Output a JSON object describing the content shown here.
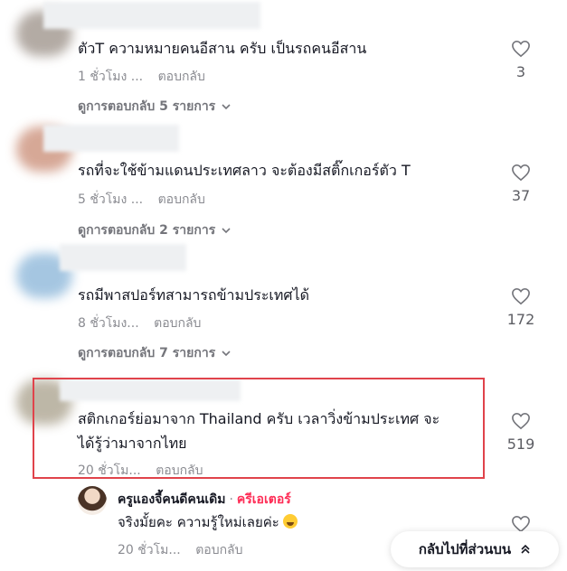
{
  "comments": [
    {
      "text_lines": [
        "ตัวT ความหมายคนอีสาน ครับ เป็นรถคนอีสาน"
      ],
      "time": "1 ชั่วโมง ...",
      "reply_label": "ตอบกลับ",
      "view_replies": "ดูการตอบกลับ 5 รายการ",
      "likes": "3",
      "avatar_color": "#9a8f86"
    },
    {
      "text_lines": [
        "รถที่จะใช้ข้ามแดนประเทศลาว จะต้องมีสติ๊กเกอร์ตัว T"
      ],
      "time": "5 ชั่วโมง ...",
      "reply_label": "ตอบกลับ",
      "view_replies": "ดูการตอบกลับ 2 รายการ",
      "likes": "37",
      "avatar_color": "#c98b74"
    },
    {
      "text_lines": [
        "รถมีพาสปอร์ทสามารถข้ามประเทศได้"
      ],
      "time": "8 ชั่วโมง...",
      "reply_label": "ตอบกลับ",
      "view_replies": "ดูการตอบกลับ 7 รายการ",
      "likes": "172",
      "avatar_color": "#88b4d8"
    },
    {
      "text_lines": [
        "สติกเกอร์ย่อมาจาก Thailand ครับ เวลาวิ่งข้ามประเทศ จะ",
        "ได้รู้ว่ามาจากไทย"
      ],
      "time": "20 ชั่วโม...",
      "reply_label": "ตอบกลับ",
      "likes": "519",
      "avatar_color": "#a89f8a"
    }
  ],
  "reply": {
    "author": "ครูแองจี้คนดีคนเดิม",
    "separator": "·",
    "creator_badge": "ครีเอเตอร์",
    "text": "จริงมั้ยคะ ความรู้ใหม่เลยค่ะ",
    "time": "20 ชั่วโม...",
    "reply_label": "ตอบกลับ"
  },
  "back_to_top": {
    "label": "กลับไปที่ส่วนบน",
    "icon": "double-chevron-up-icon"
  },
  "colors": {
    "highlight_border": "#e0434b",
    "creator_badge": "#fe2c55"
  }
}
